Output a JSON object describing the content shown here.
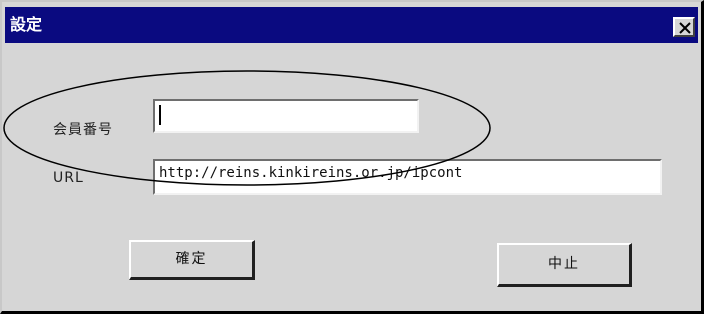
{
  "window": {
    "title": "設定"
  },
  "form": {
    "member_label": "会員番号",
    "member_value": "",
    "url_label": "URL",
    "url_value": "http://reins.kinkireins.or.jp/ipcont"
  },
  "buttons": {
    "ok_label": "確定",
    "cancel_label": "中止"
  },
  "icons": {
    "close": "close-icon"
  },
  "colors": {
    "titlebar": "#0a0a80",
    "annotation_oval": "#000000"
  }
}
